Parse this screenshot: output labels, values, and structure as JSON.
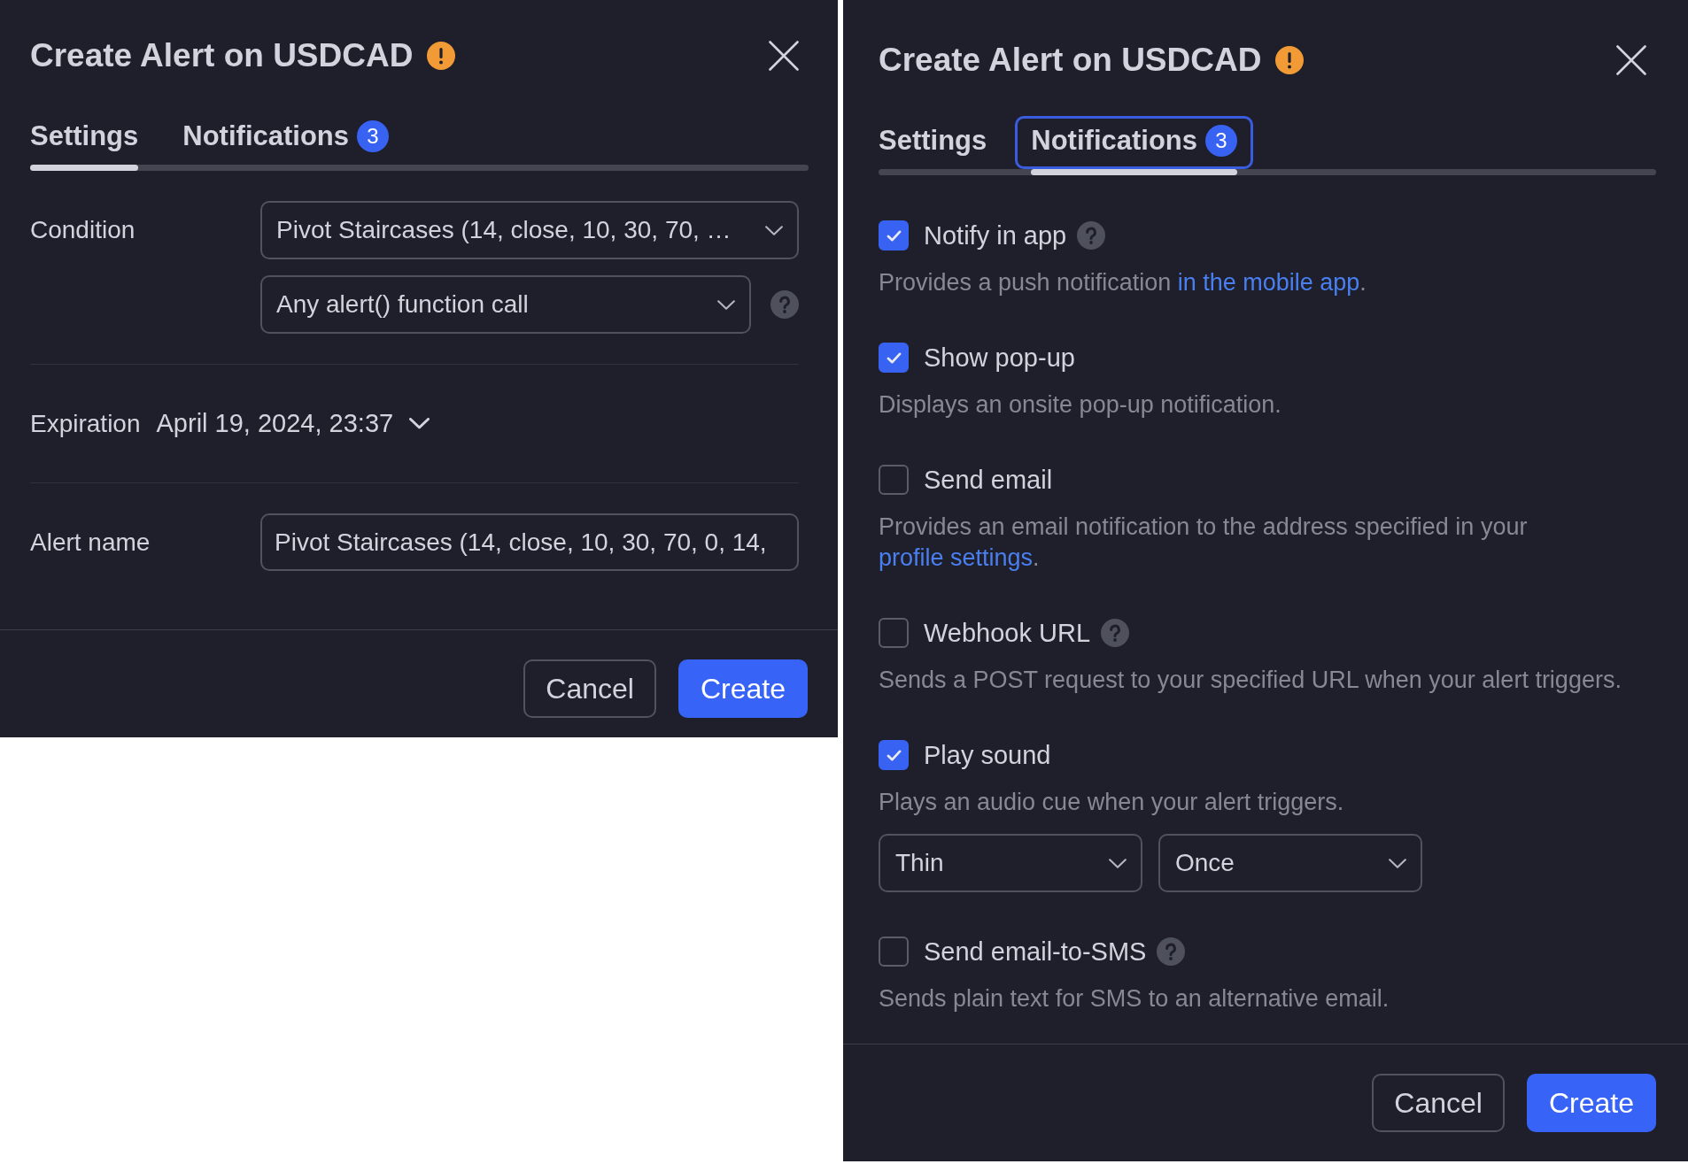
{
  "dialogs": [
    {
      "title": "Create Alert on USDCAD",
      "tabs": [
        {
          "label": "Settings",
          "selected": true,
          "focused": false
        },
        {
          "label": "Notifications",
          "badge": "3",
          "selected": false,
          "focused": false
        }
      ],
      "settings": [
        {
          "label": "Condition",
          "kind": "dropdowns",
          "controls": [
            {
              "value": "Pivot Staircases (14, close, 10, 30, 70, …",
              "help": false
            },
            {
              "value": "Any alert() function call",
              "help": true
            }
          ]
        },
        {
          "label": "Expiration",
          "kind": "date",
          "value": "April 19, 2024, 23:37"
        },
        {
          "label": "Alert name",
          "kind": "text",
          "value": "Pivot Staircases (14, close, 10, 30, 70, 0, 14,"
        }
      ],
      "buttons": [
        {
          "label": "Cancel",
          "kind": "secondary"
        },
        {
          "label": "Create",
          "kind": "primary"
        }
      ]
    },
    {
      "title": "Create Alert on USDCAD",
      "tabs": [
        {
          "label": "Settings",
          "selected": false,
          "focused": false
        },
        {
          "label": "Notifications",
          "badge": "3",
          "selected": true,
          "focused": true
        }
      ],
      "notifications": [
        {
          "label": "Notify in app",
          "checked": true,
          "help": true,
          "description": [
            {
              "kind": "text",
              "text": "Provides a push notification "
            },
            {
              "kind": "link",
              "text": "in the mobile app"
            },
            {
              "kind": "text",
              "text": "."
            }
          ]
        },
        {
          "label": "Show pop-up",
          "checked": true,
          "help": false,
          "description": [
            {
              "kind": "text",
              "text": "Displays an onsite pop-up notification."
            }
          ]
        },
        {
          "label": "Send email",
          "checked": false,
          "help": false,
          "description": [
            {
              "kind": "text",
              "text": "Provides an email notification to the address specified in your "
            },
            {
              "kind": "link",
              "text": "profile settings"
            },
            {
              "kind": "text",
              "text": "."
            }
          ]
        },
        {
          "label": "Webhook URL",
          "checked": false,
          "help": true,
          "description": [
            {
              "kind": "text",
              "text": "Sends a POST request to your specified URL when your alert triggers."
            }
          ]
        },
        {
          "label": "Play sound",
          "checked": true,
          "help": false,
          "description": [
            {
              "kind": "text",
              "text": "Plays an audio cue when your alert triggers."
            }
          ],
          "options": [
            {
              "value": "Thin"
            },
            {
              "value": "Once"
            }
          ]
        },
        {
          "label": "Send email-to-SMS",
          "checked": false,
          "help": true,
          "description": [
            {
              "kind": "text",
              "text": "Sends plain text for SMS to an alternative email."
            }
          ]
        }
      ],
      "buttons": [
        {
          "label": "Cancel",
          "kind": "secondary"
        },
        {
          "label": "Create",
          "kind": "primary"
        }
      ]
    }
  ]
}
